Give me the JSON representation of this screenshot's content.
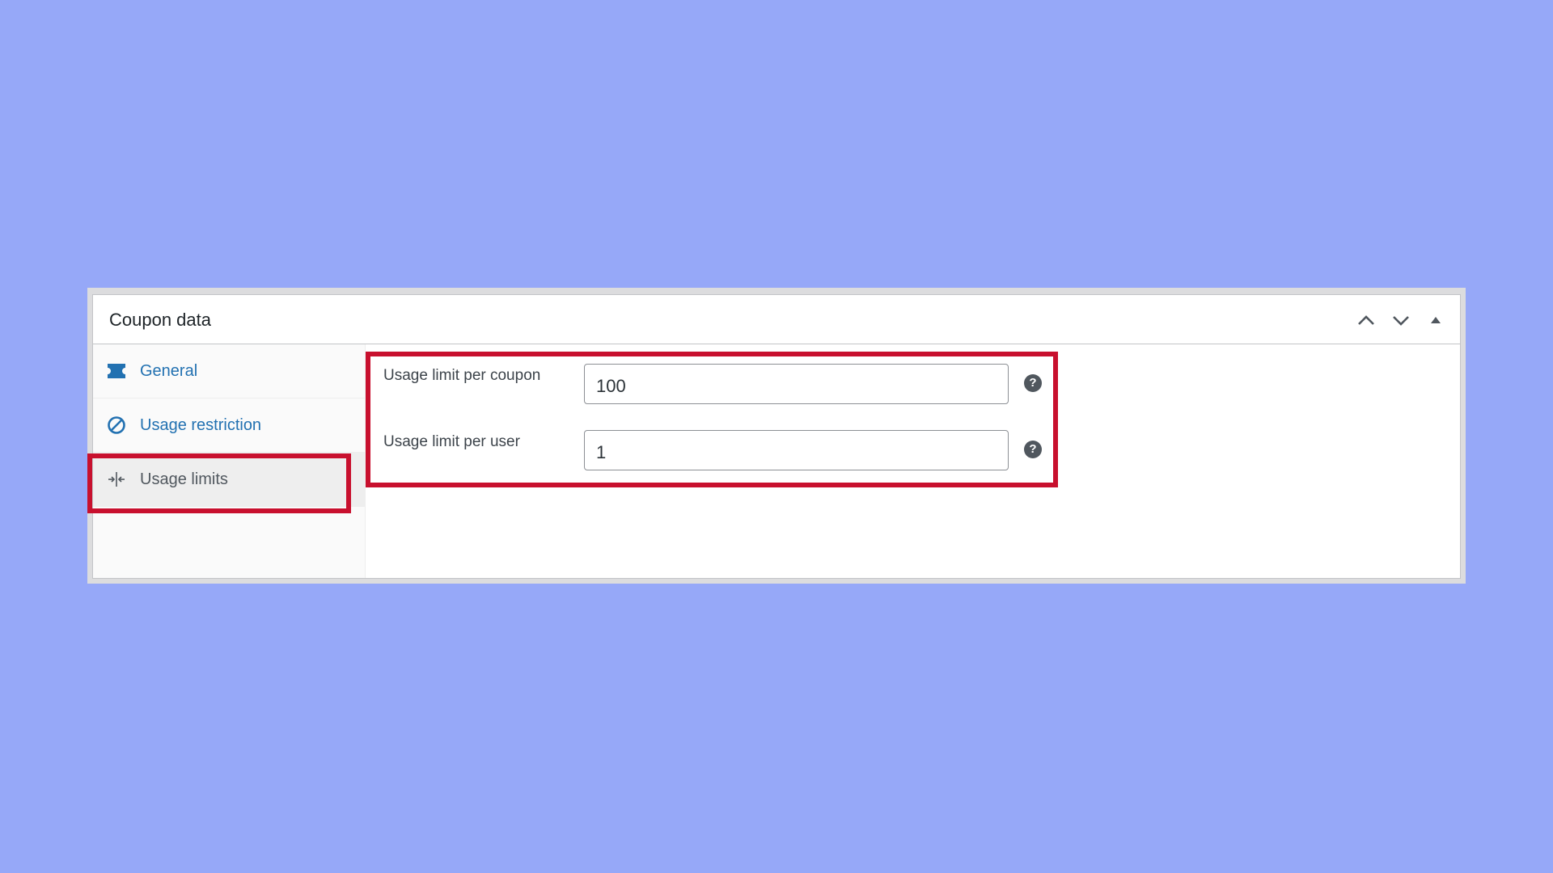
{
  "panel": {
    "title": "Coupon data",
    "controls": [
      {
        "name": "move-up-button",
        "icon": "chevron-up-icon"
      },
      {
        "name": "move-down-button",
        "icon": "chevron-down-icon"
      },
      {
        "name": "toggle-panel-button",
        "icon": "triangle-up-icon"
      }
    ]
  },
  "sidebar": {
    "tabs": [
      {
        "label": "General",
        "icon": "ticket-icon"
      },
      {
        "label": "Usage restriction",
        "icon": "no-entry-icon"
      },
      {
        "label": "Usage limits",
        "icon": "arrows-in-icon"
      }
    ],
    "active_tab": "Usage limits"
  },
  "usage_limits": {
    "per_coupon": {
      "label": "Usage limit per coupon",
      "value": "100",
      "help": "?"
    },
    "per_user": {
      "label": "Usage limit per user",
      "value": "1",
      "help": "?"
    }
  },
  "colors": {
    "background": "#96a8f8",
    "highlight": "#c8102e",
    "link": "#2271b1"
  }
}
